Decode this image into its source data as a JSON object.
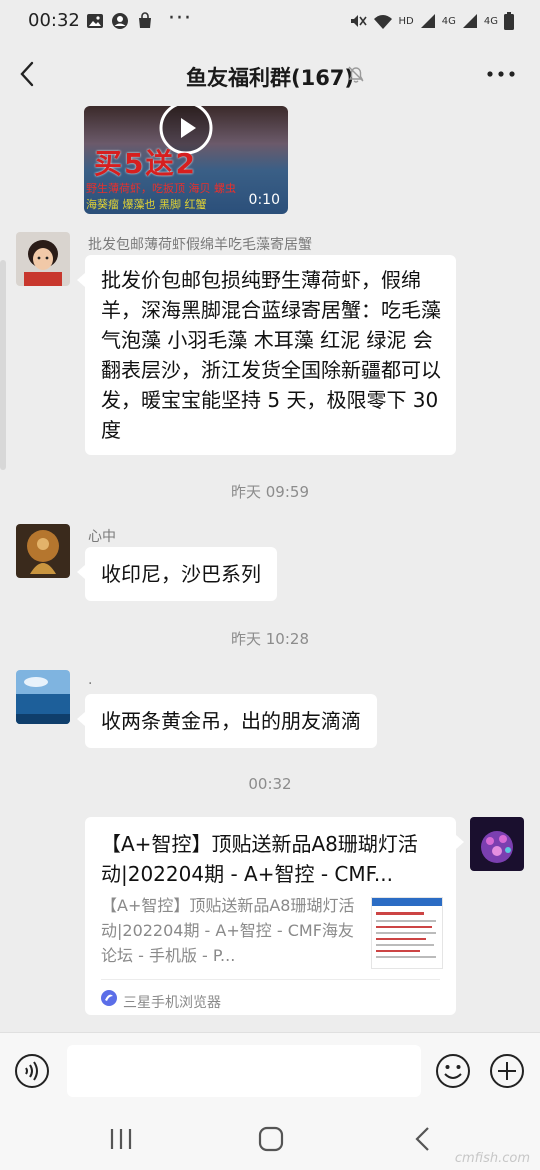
{
  "status_bar": {
    "time": "00:32",
    "dots": "···",
    "network_labels": [
      "HD",
      "4G",
      "4G"
    ]
  },
  "header": {
    "title": "鱼友福利群(167)"
  },
  "video_message": {
    "promo_text": "买5送2",
    "line1": "野生薄荷虾，吃扳顶 海贝 螺虫",
    "line2": "海葵瘤 爆藻也 黑脚 红蟹",
    "duration": "0:10"
  },
  "messages": [
    {
      "sender": "批发包邮薄荷虾假绵羊吃毛藻寄居蟹",
      "text": "批发价包邮包损纯野生薄荷虾，假绵羊，深海黑脚混合蓝绿寄居蟹：吃毛藻 气泡藻 小羽毛藻 木耳藻 红泥 绿泥 会翻表层沙，浙江发货全国除新疆都可以发，暖宝宝能坚持 5 天，极限零下 30 度"
    },
    {
      "timestamp": "昨天 09:59"
    },
    {
      "sender": "心中",
      "text": "收印尼，沙巴系列"
    },
    {
      "timestamp": "昨天 10:28"
    },
    {
      "sender": ".",
      "text": "收两条黄金吊，出的朋友滴滴"
    },
    {
      "timestamp": "00:32"
    }
  ],
  "link_card": {
    "title": "【A+智控】顶贴送新品A8珊瑚灯活动|202204期 - A+智控 - CMF...",
    "description": "【A+智控】顶贴送新品A8珊瑚灯活动|202204期 - A+智控 - CMF海友论坛 - 手机版 - P...",
    "source": "三星手机浏览器"
  },
  "input_bar": {
    "placeholder": ""
  },
  "watermark": "cmfish.com",
  "colors": {
    "background": "#ededed",
    "bubble": "#ffffff",
    "timestamp": "#8c8c8c"
  }
}
